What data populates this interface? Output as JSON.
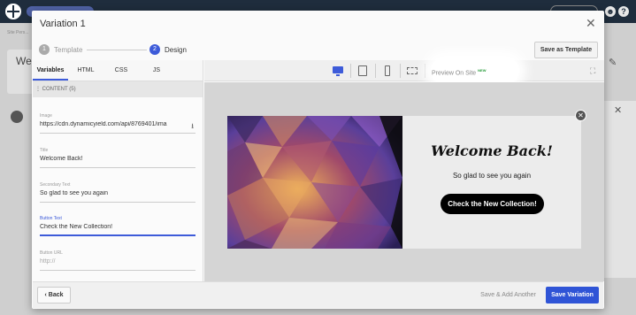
{
  "background": {
    "breadcrumb": "Site Pers...",
    "heading_fragment": "We",
    "edit_icon": "pencil-icon",
    "close_icon": "close-icon"
  },
  "topbar": {
    "logo": "grid-logo-icon",
    "icons": [
      "user-icon",
      "help-icon"
    ]
  },
  "modal": {
    "title": "Variation 1",
    "close_symbol": "✕",
    "steps": [
      {
        "num": "1",
        "label": "Template"
      },
      {
        "num": "2",
        "label": "Design"
      }
    ],
    "save_template_label": "Save as Template"
  },
  "editor": {
    "tabs": [
      {
        "label": "Variables",
        "active": true
      },
      {
        "label": "HTML",
        "active": false
      },
      {
        "label": "CSS",
        "active": false
      },
      {
        "label": "JS",
        "active": false
      }
    ],
    "content_header": "CONTENT (5)",
    "fields": {
      "image": {
        "label": "Image",
        "value": "https://cdn.dynamicyield.com/api/8769401/ima"
      },
      "title": {
        "label": "Title",
        "value": "Welcome Back!"
      },
      "secondary": {
        "label": "Secondary Text",
        "value": "So glad to see you again"
      },
      "button_text": {
        "label": "Button Text",
        "value": "Check the New Collection!"
      },
      "button_url": {
        "label": "Button URL",
        "placeholder": "http://"
      }
    }
  },
  "toolbar": {
    "devices": [
      "desktop-icon",
      "tablet-icon",
      "mobile-icon",
      "fullscreen-icon"
    ],
    "active_device": "desktop-icon",
    "preview_label": "Preview On Site",
    "new_badge": "NEW",
    "expand_symbol": "⛶"
  },
  "popup": {
    "title": "Welcome Back!",
    "subtitle": "So glad to see you again",
    "button": "Check the New Collection!",
    "close_symbol": "✕"
  },
  "footer": {
    "back_label": "‹ Back",
    "save_add_label": "Save & Add Another",
    "save_variation_label": "Save Variation"
  },
  "colors": {
    "accent": "#3d5bd9",
    "primary_button": "#2f54d6",
    "topbar": "#1f2d3d",
    "new_badge": "#2a9d3c"
  }
}
